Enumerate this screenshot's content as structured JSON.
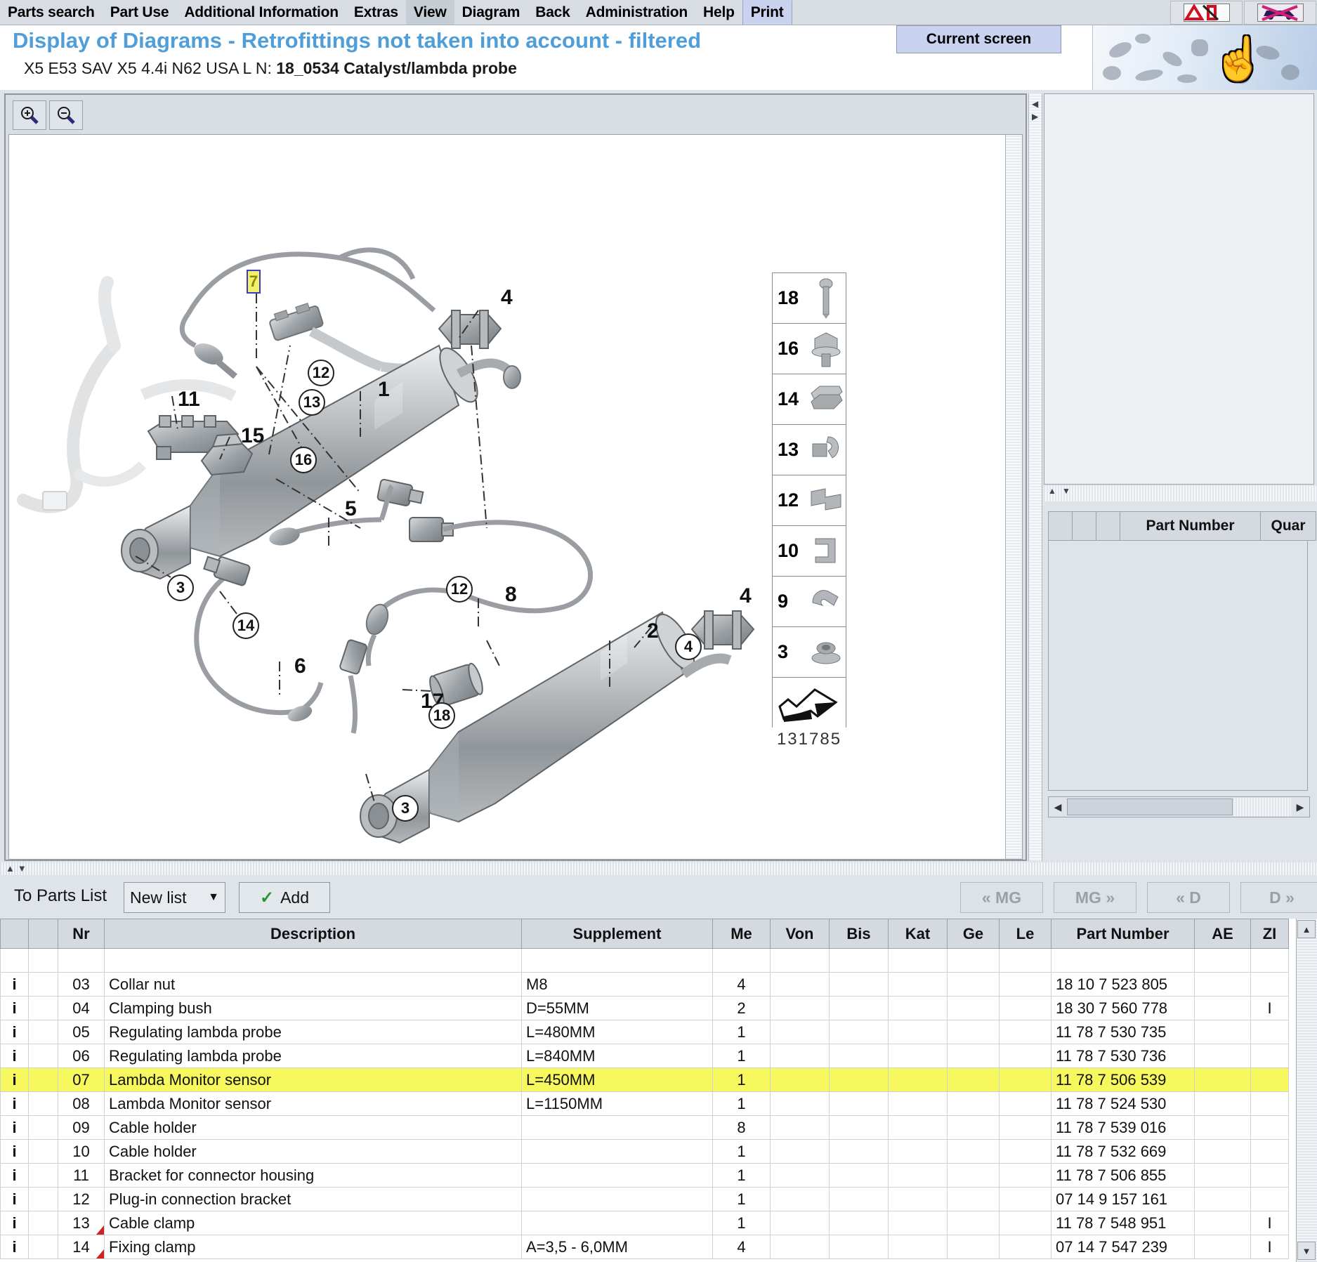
{
  "menu": {
    "items": [
      {
        "label": "Parts search",
        "state": "normal"
      },
      {
        "label": "Part Use",
        "state": "normal"
      },
      {
        "label": "Additional Information",
        "state": "normal"
      },
      {
        "label": "Extras",
        "state": "normal"
      },
      {
        "label": "View",
        "state": "hover"
      },
      {
        "label": "Diagram",
        "state": "normal"
      },
      {
        "label": "Back",
        "state": "normal"
      },
      {
        "label": "Administration",
        "state": "normal"
      },
      {
        "label": "Help",
        "state": "normal"
      },
      {
        "label": "Print",
        "state": "open"
      }
    ],
    "open_dropdown_item": "Current screen",
    "toolbar_icons": [
      "a-warning-icon",
      "no-vehicle-icon"
    ]
  },
  "header": {
    "title": "Display of Diagrams - Retrofittings not taken into account - filtered",
    "subtitle_prefix": "X5 E53 SAV X5 4.4i N62 USA  L N:",
    "subtitle_bold": "18_0534 Catalyst/lambda probe",
    "title_color": "#4f9ed9"
  },
  "diagram": {
    "zoom_in_icon": "zoom-in-icon",
    "zoom_out_icon": "zoom-out-icon",
    "drawing_number": "131785",
    "selected_callout": "7",
    "selected_callout_bg": "#f0f06a",
    "selected_callout_border": "#3b3bc0",
    "callout_numbers": [
      "1",
      "2",
      "4",
      "4",
      "5",
      "6",
      "8",
      "11",
      "15",
      "17"
    ],
    "circled_callouts": [
      "3",
      "3",
      "4",
      "12",
      "12",
      "13",
      "14",
      "16",
      "18"
    ],
    "legend_items": [
      "18",
      "16",
      "14",
      "13",
      "12",
      "10",
      "9",
      "3"
    ]
  },
  "right_panel": {
    "table_headers": [
      "",
      "",
      "",
      "Part Number",
      "Quar"
    ],
    "rows": []
  },
  "parts_list_toolbar": {
    "label": "To Parts List",
    "list_selector_value": "New list",
    "add_button": "Add",
    "nav_buttons": [
      {
        "label": "« MG",
        "enabled": false
      },
      {
        "label": "MG »",
        "enabled": false
      },
      {
        "label": "« D",
        "enabled": false
      },
      {
        "label": "D »",
        "enabled": false
      }
    ]
  },
  "parts_table": {
    "columns": [
      "",
      "",
      "Nr",
      "Description",
      "Supplement",
      "Me",
      "Von",
      "Bis",
      "Kat",
      "Ge",
      "Le",
      "Part Number",
      "AE",
      "ZI"
    ],
    "rows": [
      {
        "info": "",
        "nr": "",
        "description": "",
        "supplement": "",
        "me": "",
        "von": "",
        "bis": "",
        "kat": "",
        "ge": "",
        "le": "",
        "part_number": "",
        "ae": "",
        "zi": "",
        "highlight": false,
        "triangle": false
      },
      {
        "info": "i",
        "nr": "03",
        "description": "Collar nut",
        "supplement": "M8",
        "me": "4",
        "von": "",
        "bis": "",
        "kat": "",
        "ge": "",
        "le": "",
        "part_number": "18 10 7 523 805",
        "ae": "",
        "zi": "",
        "highlight": false,
        "triangle": false
      },
      {
        "info": "i",
        "nr": "04",
        "description": "Clamping bush",
        "supplement": "D=55MM",
        "me": "2",
        "von": "",
        "bis": "",
        "kat": "",
        "ge": "",
        "le": "",
        "part_number": "18 30 7 560 778",
        "ae": "",
        "zi": "I",
        "highlight": false,
        "triangle": false
      },
      {
        "info": "i",
        "nr": "05",
        "description": "Regulating lambda probe",
        "supplement": "L=480MM",
        "me": "1",
        "von": "",
        "bis": "",
        "kat": "",
        "ge": "",
        "le": "",
        "part_number": "11 78 7 530 735",
        "ae": "",
        "zi": "",
        "highlight": false,
        "triangle": false
      },
      {
        "info": "i",
        "nr": "06",
        "description": "Regulating lambda probe",
        "supplement": "L=840MM",
        "me": "1",
        "von": "",
        "bis": "",
        "kat": "",
        "ge": "",
        "le": "",
        "part_number": "11 78 7 530 736",
        "ae": "",
        "zi": "",
        "highlight": false,
        "triangle": false
      },
      {
        "info": "i",
        "nr": "07",
        "description": "Lambda Monitor sensor",
        "supplement": "L=450MM",
        "me": "1",
        "von": "",
        "bis": "",
        "kat": "",
        "ge": "",
        "le": "",
        "part_number": "11 78 7 506 539",
        "ae": "",
        "zi": "",
        "highlight": true,
        "triangle": false
      },
      {
        "info": "i",
        "nr": "08",
        "description": "Lambda Monitor sensor",
        "supplement": "L=1150MM",
        "me": "1",
        "von": "",
        "bis": "",
        "kat": "",
        "ge": "",
        "le": "",
        "part_number": "11 78 7 524 530",
        "ae": "",
        "zi": "",
        "highlight": false,
        "triangle": false
      },
      {
        "info": "i",
        "nr": "09",
        "description": "Cable holder",
        "supplement": "",
        "me": "8",
        "von": "",
        "bis": "",
        "kat": "",
        "ge": "",
        "le": "",
        "part_number": "11 78 7 539 016",
        "ae": "",
        "zi": "",
        "highlight": false,
        "triangle": false
      },
      {
        "info": "i",
        "nr": "10",
        "description": "Cable holder",
        "supplement": "",
        "me": "1",
        "von": "",
        "bis": "",
        "kat": "",
        "ge": "",
        "le": "",
        "part_number": "11 78 7 532 669",
        "ae": "",
        "zi": "",
        "highlight": false,
        "triangle": false
      },
      {
        "info": "i",
        "nr": "11",
        "description": "Bracket for connector housing",
        "supplement": "",
        "me": "1",
        "von": "",
        "bis": "",
        "kat": "",
        "ge": "",
        "le": "",
        "part_number": "11 78 7 506 855",
        "ae": "",
        "zi": "",
        "highlight": false,
        "triangle": false
      },
      {
        "info": "i",
        "nr": "12",
        "description": "Plug-in connection bracket",
        "supplement": "",
        "me": "1",
        "von": "",
        "bis": "",
        "kat": "",
        "ge": "",
        "le": "",
        "part_number": "07 14 9 157 161",
        "ae": "",
        "zi": "",
        "highlight": false,
        "triangle": false
      },
      {
        "info": "i",
        "nr": "13",
        "description": "Cable clamp",
        "supplement": "",
        "me": "1",
        "von": "",
        "bis": "",
        "kat": "",
        "ge": "",
        "le": "",
        "part_number": "11 78 7 548 951",
        "ae": "",
        "zi": "I",
        "highlight": false,
        "triangle": true
      },
      {
        "info": "i",
        "nr": "14",
        "description": "Fixing clamp",
        "supplement": "A=3,5 - 6,0MM",
        "me": "4",
        "von": "",
        "bis": "",
        "kat": "",
        "ge": "",
        "le": "",
        "part_number": "07 14 7 547 239",
        "ae": "",
        "zi": "I",
        "highlight": false,
        "triangle": true
      }
    ]
  },
  "colors": {
    "highlight_row": "#f7f75e",
    "menu_bg": "#d8dde3",
    "panel_bg": "#dfe4ea",
    "info_icon": "#a02030"
  }
}
